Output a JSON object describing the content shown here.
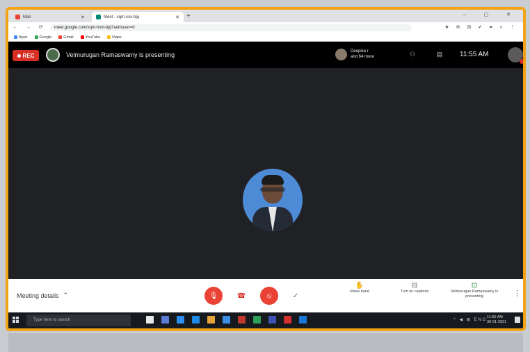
{
  "browser": {
    "tabs": [
      {
        "label": "Mail"
      },
      {
        "label": "Meet - xqm-xxx-bjq"
      }
    ],
    "new_tab": "+",
    "window_controls": "–  ▢  ✕",
    "nav_buttons": "←  →  ⟳  ⌂",
    "url": "meet.google.com/xqm-hxxt-bjq?authuser=0",
    "extension_icons": "★  ⊕  ⊞  ✔  ➤  ◐  ⋮",
    "bookmarks": [
      {
        "label": "Apps",
        "color": "#4285f4"
      },
      {
        "label": "Google",
        "color": "#34a853"
      },
      {
        "label": "Gmail",
        "color": "#ea4335"
      },
      {
        "label": "YouTube",
        "color": "#ff0000"
      },
      {
        "label": "Maps",
        "color": "#fbbc05"
      }
    ]
  },
  "meet": {
    "rec_label": "REC",
    "presenting_text": "Velmurugan Ramaswamy is presenting",
    "participants_text_1": "Deepika r",
    "participants_text_2": "and 64 more",
    "top_icons": "⚇  ▤",
    "clock": "11:55 AM",
    "meeting_details": "Meeting details",
    "chevron": "⌃",
    "buttons": {
      "mic": "🎙",
      "hangup": "☎",
      "camera": "⦸",
      "check": "✓"
    },
    "right_controls": [
      {
        "icon": "✋",
        "label": "Raise hand"
      },
      {
        "icon": "⊟",
        "label": "Turn on captions"
      },
      {
        "icon": "⊡",
        "label": "Velmurugan Ramaswamy is presenting"
      }
    ],
    "kebab": "⋮"
  },
  "taskbar": {
    "search_placeholder": "Type here to search",
    "apps": [
      "#e8e8e8",
      "#5b7bd5",
      "#2d8ff0",
      "#1e88e5",
      "#e8a23a",
      "#3a8ee6",
      "#c0392b",
      "#2e9e5b",
      "#3f51b5",
      "#d32f2f",
      "#1976d2"
    ],
    "tray_icons": "^ ◀ ⊞ ENG",
    "time": "11:55 AM",
    "date": "30-01-2021"
  }
}
